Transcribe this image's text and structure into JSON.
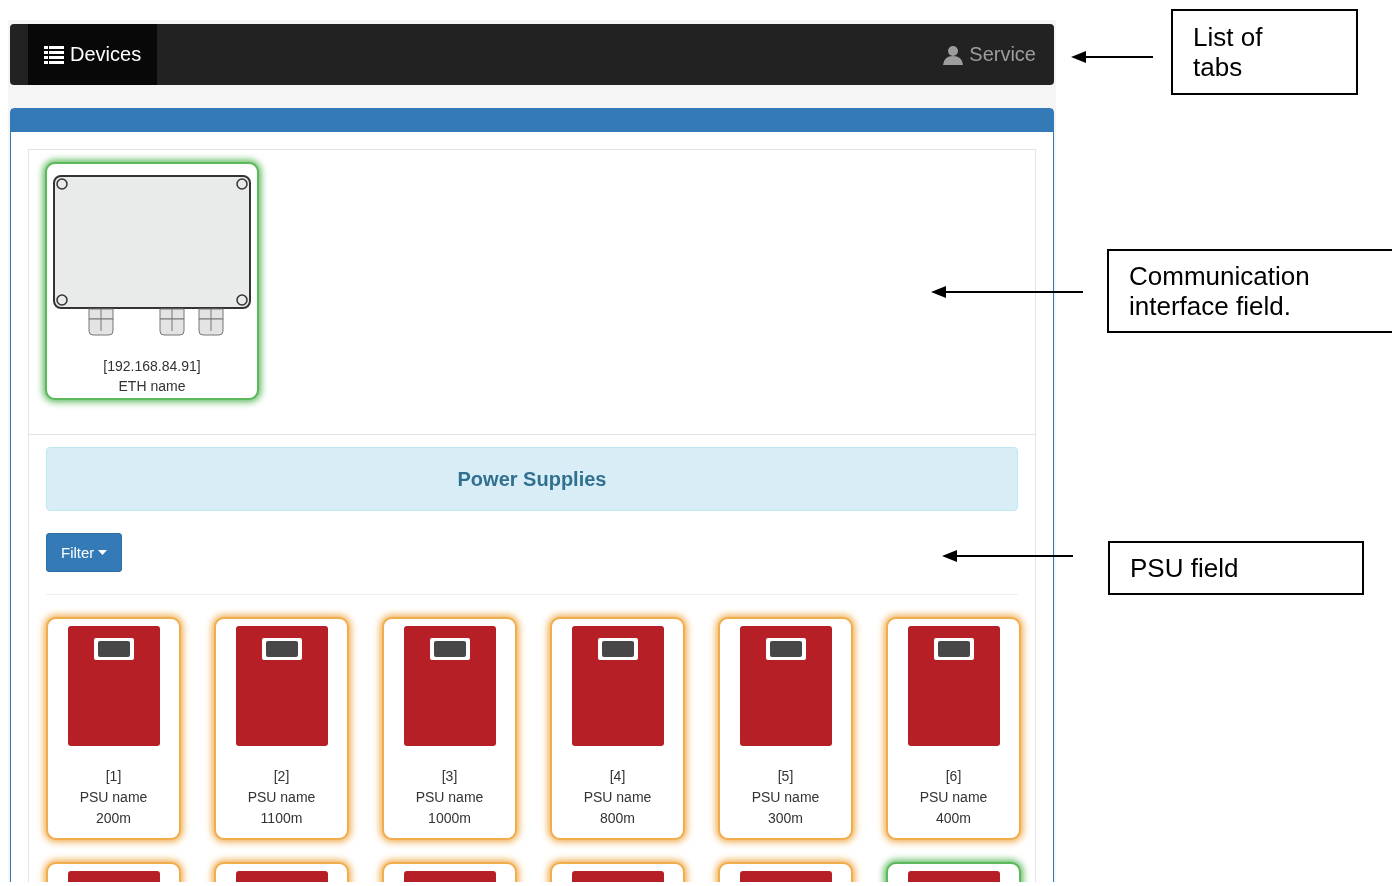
{
  "navbar": {
    "tabs": [
      {
        "label": "Devices",
        "kind": "list",
        "selected": true
      },
      {
        "label": "Service",
        "kind": "user",
        "selected": false
      }
    ]
  },
  "interfaces": [
    {
      "address": "[192.168.84.91]",
      "name": "ETH name",
      "color": "#5cb85c"
    }
  ],
  "power_supplies": {
    "title": "Power Supplies",
    "filter_button": "Filter",
    "units": [
      {
        "index": "[1]",
        "name": "PSU name",
        "length": "200m",
        "color": "#f0ad4e"
      },
      {
        "index": "[2]",
        "name": "PSU name",
        "length": "1100m",
        "color": "#f0ad4e"
      },
      {
        "index": "[3]",
        "name": "PSU name",
        "length": "1000m",
        "color": "#f0ad4e"
      },
      {
        "index": "[4]",
        "name": "PSU name",
        "length": "800m",
        "color": "#f0ad4e"
      },
      {
        "index": "[5]",
        "name": "PSU name",
        "length": "300m",
        "color": "#f0ad4e"
      },
      {
        "index": "[6]",
        "name": "PSU name",
        "length": "400m",
        "color": "#f0ad4e"
      },
      {
        "color": "#f0ad4e"
      },
      {
        "color": "#f0ad4e"
      },
      {
        "color": "#f0ad4e"
      },
      {
        "color": "#f0ad4e"
      },
      {
        "color": "#f0ad4e"
      },
      {
        "color": "#5cb85c"
      }
    ]
  },
  "callouts": [
    {
      "text": "List of\ntabs"
    },
    {
      "text": "Communication\ninterface field."
    },
    {
      "text": "PSU field"
    }
  ]
}
